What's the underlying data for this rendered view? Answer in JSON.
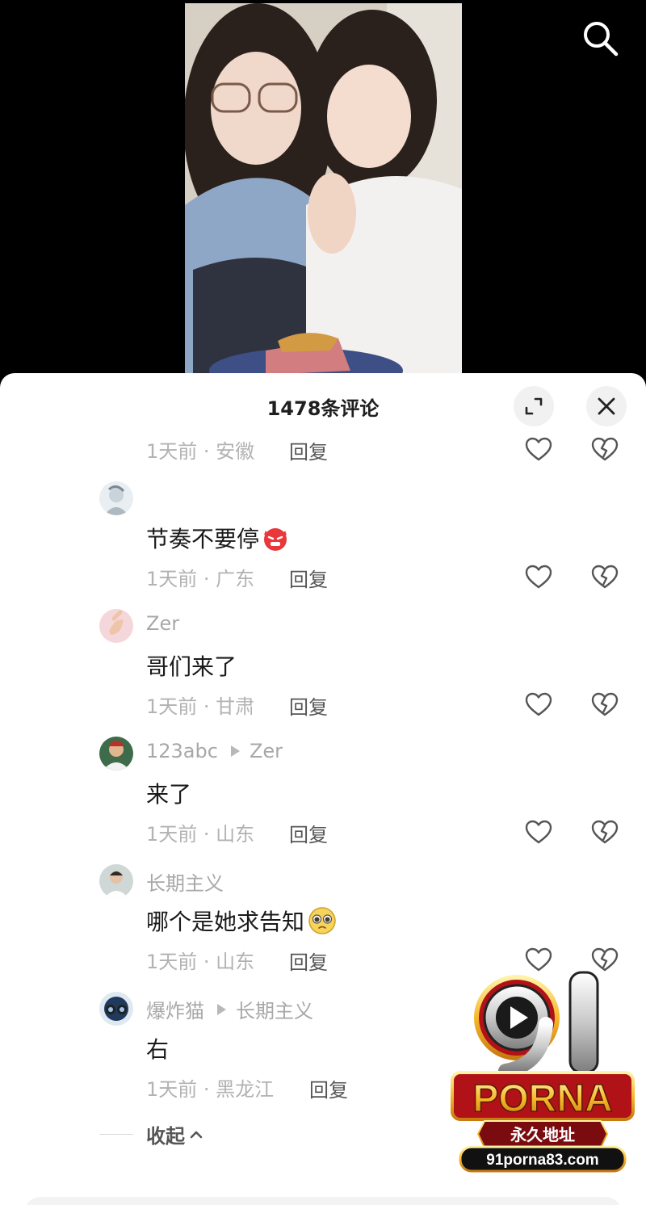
{
  "icons": {
    "search": "search-icon",
    "expand": "expand-icon",
    "close": "close-icon",
    "like": "heart-icon",
    "dislike": "broken-heart-icon",
    "collapse": "chevron-up-icon"
  },
  "comments_panel": {
    "title": "1478条评论",
    "reply_label": "回复",
    "collapse_label": "收起",
    "top_meta": "1天前 · 安徽",
    "comments": [
      {
        "user": "",
        "reply_to": "",
        "text": "节奏不要停",
        "emoji": "angry-devil",
        "meta": "1天前 · 广东"
      },
      {
        "user": "Zer",
        "reply_to": "",
        "text": "哥们来了",
        "emoji": "",
        "meta": "1天前 · 甘肃"
      },
      {
        "user": "123abc",
        "reply_to": "Zer",
        "text": "来了",
        "emoji": "",
        "meta": "1天前 · 山东"
      },
      {
        "user": "长期主义",
        "reply_to": "",
        "text": "哪个是她求告知",
        "emoji": "pleading-face",
        "meta": "1天前 · 山东"
      },
      {
        "user": "爆炸猫",
        "reply_to": "长期主义",
        "text": "右",
        "emoji": "",
        "meta": "1天前 · 黑龙江"
      }
    ]
  },
  "watermark": {
    "logo_number": "91",
    "logo_word": "PORNA",
    "tagline": "永久地址",
    "url": "91porna83.com"
  },
  "colors": {
    "background": "#000000",
    "sheet": "#ffffff",
    "meta_text": "#b2b2b2",
    "watermark_gold": "#f6b82a",
    "watermark_red": "#c0151b"
  }
}
